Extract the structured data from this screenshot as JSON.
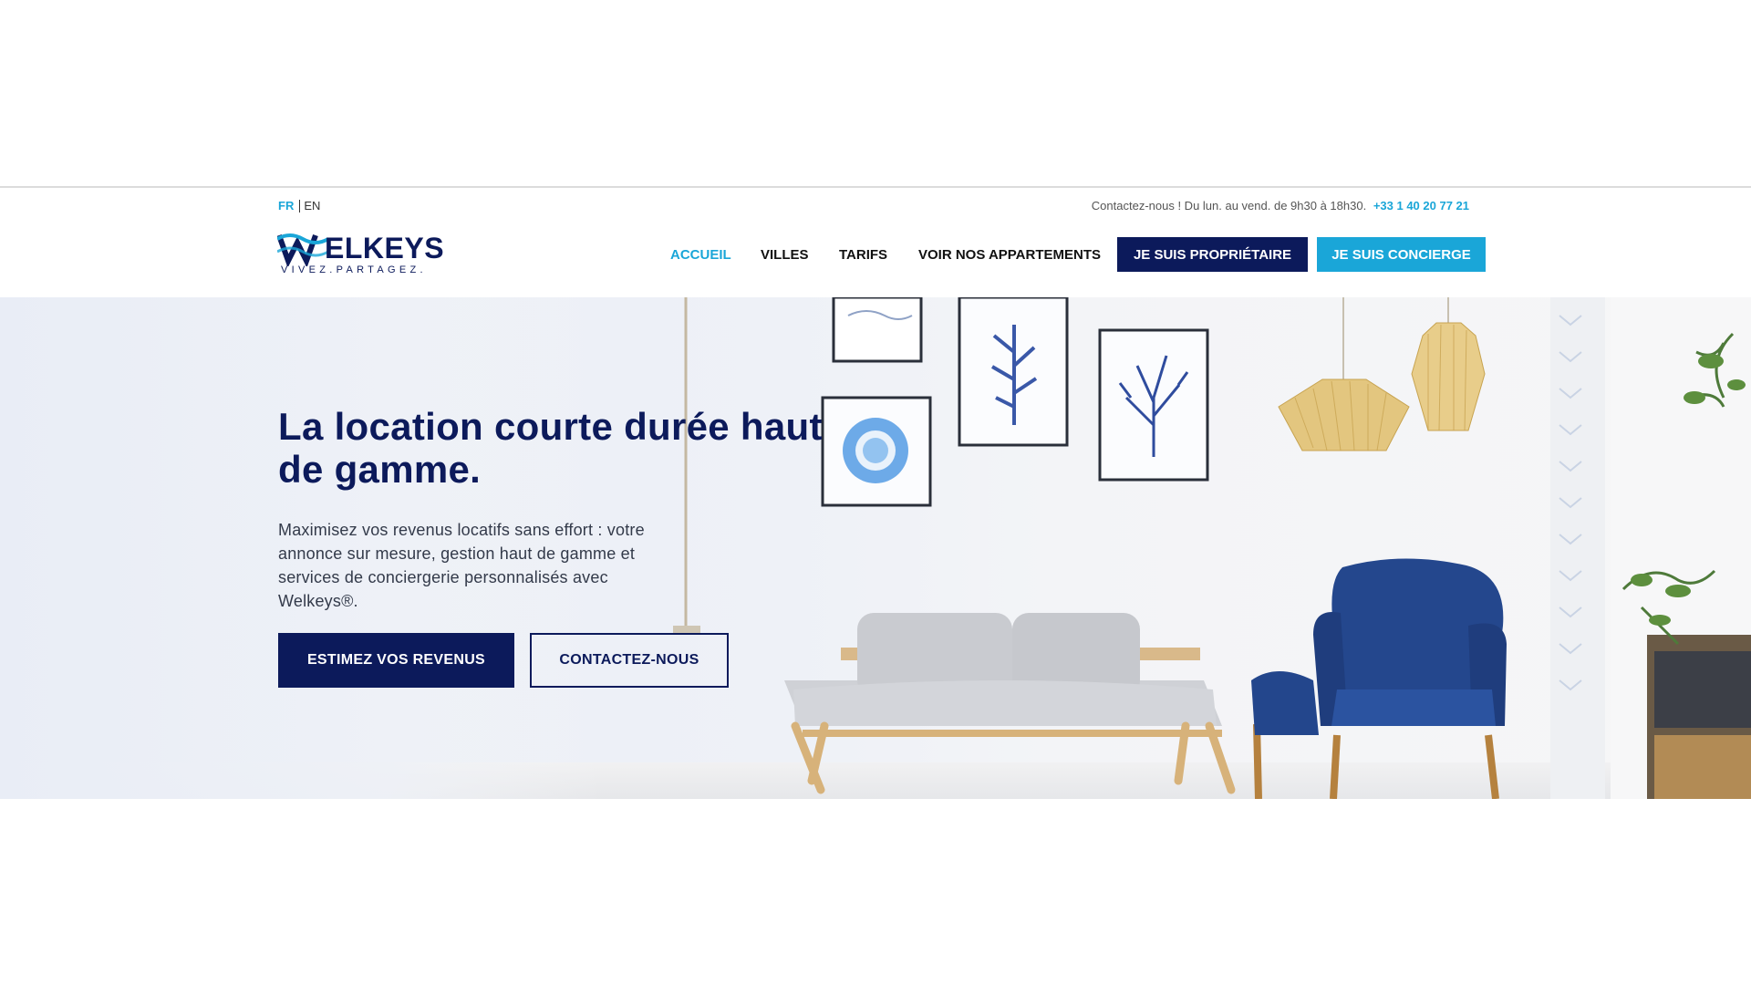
{
  "language": {
    "fr": "FR",
    "en": "EN"
  },
  "contact": {
    "text": "Contactez-nous ! Du lun. au vend. de 9h30 à 18h30.",
    "phone": "+33 1 40 20 77 21"
  },
  "logo": {
    "name": "ELKEYS",
    "tagline": "VIVEZ.PARTAGEZ."
  },
  "nav": {
    "items": [
      {
        "label": "ACCUEIL",
        "active": true
      },
      {
        "label": "VILLES",
        "active": false
      },
      {
        "label": "TARIFS",
        "active": false
      },
      {
        "label": "VOIR NOS APPARTEMENTS",
        "active": false
      }
    ],
    "owner_button": "JE SUIS PROPRIÉTAIRE",
    "concierge_button": "JE SUIS CONCIERGE"
  },
  "hero": {
    "title": "La location courte durée haut de gamme.",
    "text": "Maximisez vos revenus locatifs sans effort : votre annonce sur mesure, gestion haut de gamme et services de conciergerie personnalisés avec Welkeys®.",
    "estimate_button": "ESTIMEZ VOS REVENUS",
    "contact_button": "CONTACTEZ-NOUS"
  },
  "colors": {
    "navy": "#0c1a5b",
    "cyan": "#1aa6d8",
    "white": "#ffffff"
  }
}
